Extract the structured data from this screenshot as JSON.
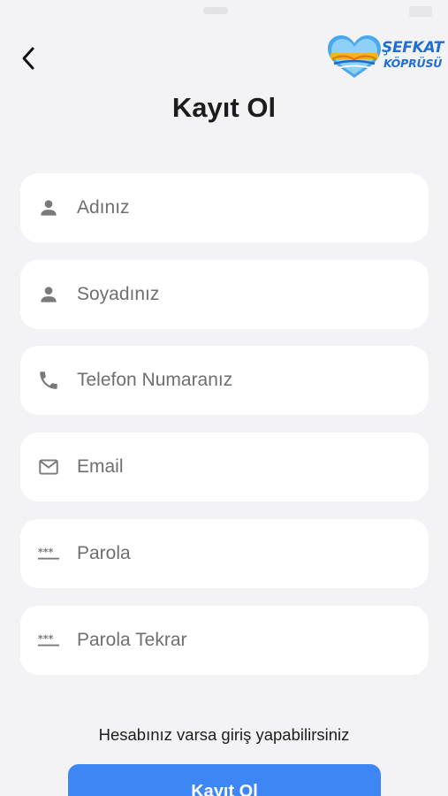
{
  "header": {
    "back_icon": "chevron-left-icon",
    "logo_line1": "ŞEFKAT",
    "logo_line2": "KÖPRÜSÜ",
    "title": "Kayıt Ol"
  },
  "form": {
    "fields": [
      {
        "placeholder": "Adınız",
        "icon": "person-icon",
        "type": "text"
      },
      {
        "placeholder": "Soyadınız",
        "icon": "person-icon",
        "type": "text"
      },
      {
        "placeholder": "Telefon Numaranız",
        "icon": "phone-icon",
        "type": "tel"
      },
      {
        "placeholder": "Email",
        "icon": "mail-icon",
        "type": "email"
      },
      {
        "placeholder": "Parola",
        "icon": "password-icon",
        "type": "password"
      },
      {
        "placeholder": "Parola Tekrar",
        "icon": "password-icon",
        "type": "password"
      }
    ]
  },
  "footer": {
    "login_hint": "Hesabınız varsa giriş yapabilirsiniz",
    "submit_label": "Kayıt Ol"
  },
  "colors": {
    "background": "#f3f3f5",
    "field_background": "#ffffff",
    "primary_button": "#3d86f5",
    "icon_gray": "#7a7a7a",
    "logo_blue": "#1f6fd6"
  }
}
